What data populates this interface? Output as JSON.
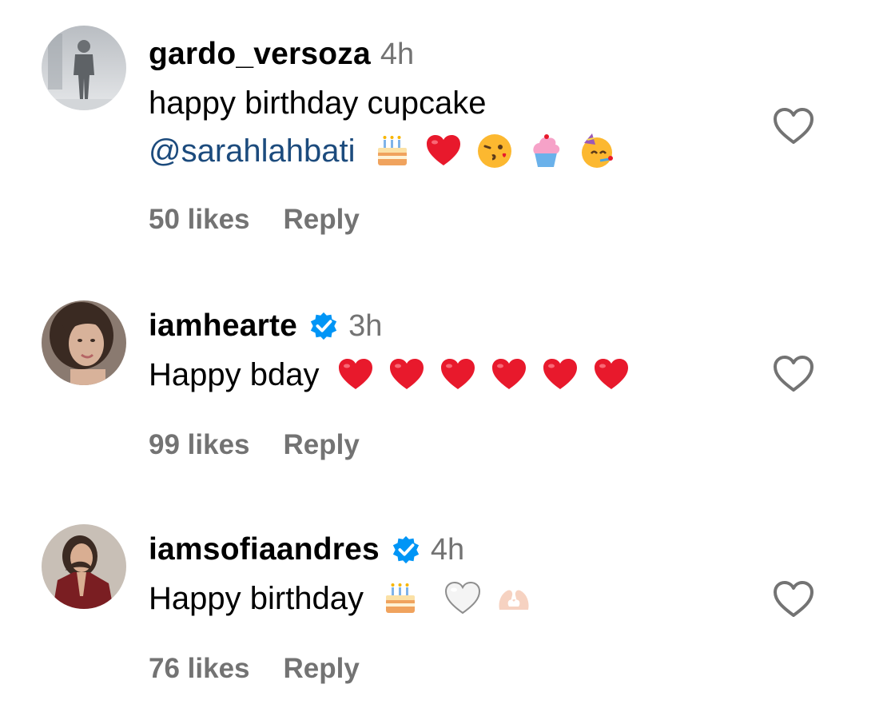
{
  "comments": [
    {
      "username": "gardo_versoza",
      "verified": false,
      "time": "4h",
      "text_lines": [
        "happy birthday cupcake"
      ],
      "mention": "@sarahlahbati",
      "emojis": [
        "birthday-cake",
        "red-heart",
        "kissing-face",
        "cupcake",
        "partying-face"
      ],
      "likes": "50 likes",
      "reply": "Reply"
    },
    {
      "username": "iamhearte",
      "verified": true,
      "time": "3h",
      "text": "Happy bday",
      "emojis": [
        "red-heart",
        "red-heart",
        "red-heart",
        "red-heart",
        "red-heart",
        "red-heart"
      ],
      "likes": "99 likes",
      "reply": "Reply"
    },
    {
      "username": "iamsofiaandres",
      "verified": true,
      "time": "4h",
      "text": "Happy birthday",
      "emojis": [
        "birthday-cake",
        "white-heart",
        "heart-hands"
      ],
      "likes": "76 likes",
      "reply": "Reply"
    }
  ],
  "colors": {
    "username": "#000000",
    "meta": "#737373",
    "mention": "#1c4b7d",
    "verified": "#0095f6",
    "like_icon": "#737373"
  }
}
